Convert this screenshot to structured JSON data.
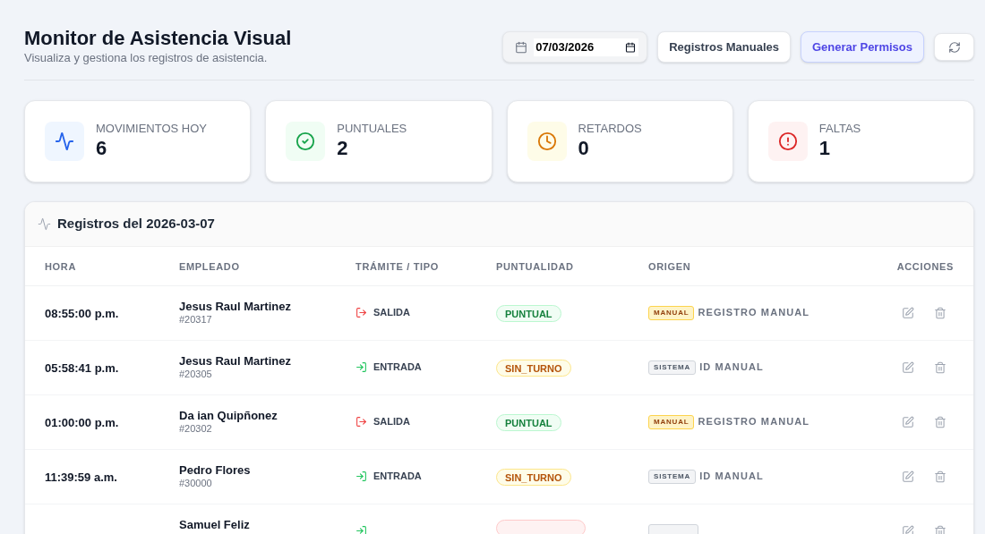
{
  "header": {
    "title": "Monitor de Asistencia Visual",
    "subtitle": "Visualiza y gestiona los registros de asistencia."
  },
  "toolbar": {
    "date": "07/03/2026",
    "buttons": [
      {
        "kind": "outline",
        "label": "Registros Manuales"
      },
      {
        "kind": "accent",
        "label": "Generar Permisos"
      },
      {
        "kind": "refresh"
      }
    ]
  },
  "stats": [
    {
      "kind": "activity",
      "label": "MOVIMIENTOS HOY",
      "value": "6"
    },
    {
      "kind": "check",
      "label": "PUNTUALES",
      "value": "2"
    },
    {
      "kind": "clock",
      "label": "RETARDOS",
      "value": "0"
    },
    {
      "kind": "alert",
      "label": "FALTAS",
      "value": "1"
    }
  ],
  "table": {
    "title": "Registros del 2026-03-07",
    "columns": [
      "HORA",
      "EMPLEADO",
      "TRÁMITE / TIPO",
      "PUNTUALIDAD",
      "ORIGEN",
      "ACCIONES"
    ],
    "rows": [
      {
        "time": "08:55:00 p.m.",
        "employee": "Jesus Raul Martinez",
        "employee_id": "#20317",
        "type": {
          "kind": "salida",
          "label": "SALIDA"
        },
        "punctuality": {
          "kind": "puntual",
          "label": "PUNTUAL"
        },
        "origin": {
          "kind": "manual",
          "tag": "MANUAL",
          "label": "REGISTRO MANUAL"
        }
      },
      {
        "time": "05:58:41 p.m.",
        "employee": "Jesus Raul Martinez",
        "employee_id": "#20305",
        "type": {
          "kind": "entrada",
          "label": "ENTRADA"
        },
        "punctuality": {
          "kind": "sin_turno",
          "label": "SIN_TURNO"
        },
        "origin": {
          "kind": "sistema",
          "tag": "SISTEMA",
          "label": "ID MANUAL"
        }
      },
      {
        "time": "01:00:00 p.m.",
        "employee": "Da ian Quipñonez",
        "employee_id": "#20302",
        "type": {
          "kind": "salida",
          "label": "SALIDA"
        },
        "punctuality": {
          "kind": "puntual",
          "label": "PUNTUAL"
        },
        "origin": {
          "kind": "manual",
          "tag": "MANUAL",
          "label": "REGISTRO MANUAL"
        }
      },
      {
        "time": "11:39:59 a.m.",
        "employee": "Pedro Flores",
        "employee_id": "#30000",
        "type": {
          "kind": "entrada",
          "label": "ENTRADA"
        },
        "punctuality": {
          "kind": "sin_turno",
          "label": "SIN_TURNO"
        },
        "origin": {
          "kind": "sistema",
          "tag": "SISTEMA",
          "label": "ID MANUAL"
        }
      },
      {
        "employee": "Samuel Feliz",
        "type": {
          "kind": "entrada"
        },
        "punctuality": {
          "kind": "falta"
        },
        "origin": {
          "kind": "sistema"
        }
      }
    ]
  }
}
